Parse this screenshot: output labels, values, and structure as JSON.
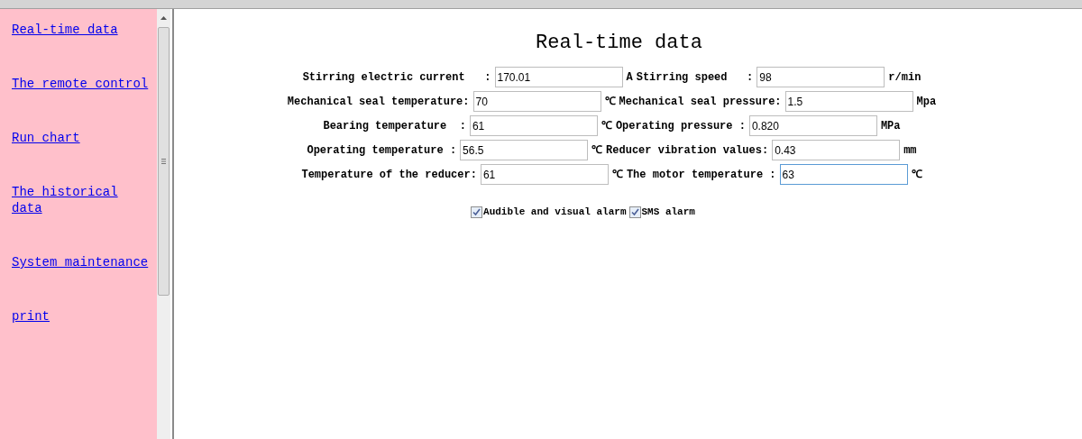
{
  "sidebar": {
    "links": [
      {
        "label": "Real-time data"
      },
      {
        "label": "The remote control"
      },
      {
        "label": "Run chart"
      },
      {
        "label": "The historical data"
      },
      {
        "label": "System maintenance"
      },
      {
        "label": "print"
      }
    ]
  },
  "main": {
    "title": "Real-time data",
    "rows": [
      {
        "fields": [
          {
            "label": "Stirring electric current   :",
            "value": "170.01",
            "unit": "A",
            "focused": false
          },
          {
            "label": "Stirring speed   :",
            "value": "98",
            "unit": "r/min",
            "focused": false
          }
        ]
      },
      {
        "fields": [
          {
            "label": "Mechanical seal temperature:",
            "value": "70",
            "unit": "℃",
            "focused": false
          },
          {
            "label": "Mechanical seal pressure:",
            "value": "1.5",
            "unit": "Mpa",
            "focused": false
          }
        ]
      },
      {
        "fields": [
          {
            "label": "Bearing temperature  :",
            "value": "61",
            "unit": "℃",
            "focused": false
          },
          {
            "label": "Operating pressure :",
            "value": "0.820",
            "unit": "MPa",
            "focused": false
          }
        ]
      },
      {
        "fields": [
          {
            "label": "Operating temperature :",
            "value": "56.5",
            "unit": "℃",
            "focused": false
          },
          {
            "label": "Reducer vibration values:",
            "value": "0.43",
            "unit": "mm",
            "focused": false
          }
        ]
      },
      {
        "fields": [
          {
            "label": "Temperature of the reducer:",
            "value": "61",
            "unit": "℃",
            "focused": false
          },
          {
            "label": "The motor temperature :",
            "value": "63",
            "unit": "℃",
            "focused": true
          }
        ]
      }
    ],
    "alarms": [
      {
        "label": "Audible and visual alarm",
        "checked": true
      },
      {
        "label": "SMS alarm",
        "checked": true
      }
    ]
  }
}
